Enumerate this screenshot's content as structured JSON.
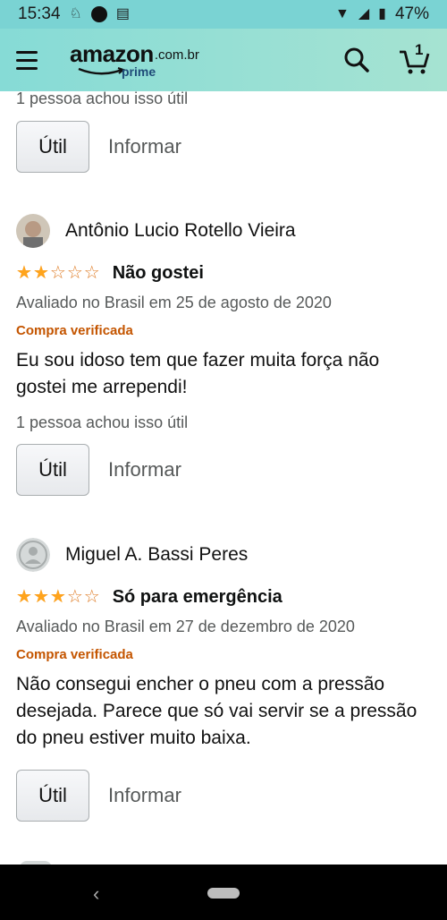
{
  "status_bar": {
    "time": "15:34",
    "battery": "47%"
  },
  "header": {
    "logo_text": "amazon",
    "logo_tld": ".com.br",
    "logo_sub": "prime",
    "cart_count": "1",
    "brand_color": "#86dbd6"
  },
  "top_fragment": {
    "helpful": "1 pessoa achou isso útil",
    "helpful_button": "Útil",
    "report_link": "Informar"
  },
  "reviews": [
    {
      "reviewer": "Antônio Lucio Rotello Vieira",
      "rating": 2,
      "title": "Não gostei",
      "date": "Avaliado no Brasil em 25 de agosto de 2020",
      "verified": "Compra verificada",
      "body": "Eu sou idoso tem que fazer muita força não gostei me arrependi!",
      "helpful": "1 pessoa achou isso útil",
      "helpful_button": "Útil",
      "report_link": "Informar"
    },
    {
      "reviewer": "Miguel A. Bassi Peres",
      "rating": 3,
      "title": "Só para emergência",
      "date": "Avaliado no Brasil em 27 de dezembro de 2020",
      "verified": "Compra verificada",
      "body": "Não consegui encher o pneu com a pressão desejada. Parece que só vai servir se a pressão do pneu estiver muito baixa.",
      "helpful_button": "Útil",
      "report_link": "Informar"
    }
  ],
  "colors": {
    "star": "#ffa41c",
    "verified": "#c45500",
    "muted_text": "#565959"
  }
}
